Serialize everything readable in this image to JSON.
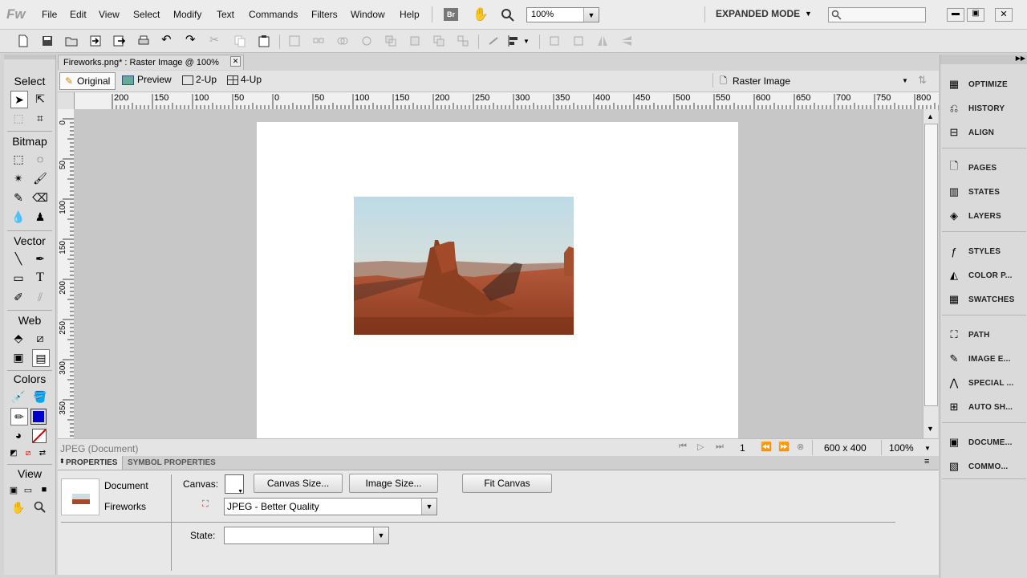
{
  "app": {
    "logo": "Fw"
  },
  "menu": [
    "File",
    "Edit",
    "View",
    "Select",
    "Modify",
    "Text",
    "Commands",
    "Filters",
    "Window",
    "Help"
  ],
  "menubar": {
    "bridge_label": "Br",
    "zoom_value": "100%",
    "mode": "EXPANDED MODE",
    "search_placeholder": ""
  },
  "doc_tab": {
    "title": "Fireworks.png* : Raster Image @ 100%"
  },
  "view_tabs": [
    "Original",
    "Preview",
    "2-Up",
    "4-Up"
  ],
  "object_type": "Raster Image",
  "ruler": {
    "h_ticks": [
      "200",
      "150",
      "100",
      "50",
      "0",
      "50",
      "100",
      "150",
      "200",
      "250",
      "300",
      "350",
      "400",
      "450",
      "500",
      "550",
      "600",
      "650",
      "700",
      "750",
      "800"
    ],
    "v_ticks": [
      "0",
      "50",
      "100",
      "150",
      "200",
      "250",
      "300",
      "350"
    ]
  },
  "tools": {
    "sections": [
      "Select",
      "Bitmap",
      "Vector",
      "Web",
      "Colors",
      "View"
    ]
  },
  "status": {
    "doc_type": "JPEG (Document)",
    "frame": "1",
    "size": "600 x 400",
    "zoom": "100%"
  },
  "properties": {
    "tabs": [
      "PROPERTIES",
      "SYMBOL PROPERTIES"
    ],
    "doc_label": "Document",
    "doc_name": "Fireworks",
    "canvas_label": "Canvas:",
    "canvas_size_btn": "Canvas Size...",
    "image_size_btn": "Image Size...",
    "fit_canvas_btn": "Fit Canvas",
    "export_format": "JPEG - Better Quality",
    "state_label": "State:",
    "state_value": ""
  },
  "panels": [
    "OPTIMIZE",
    "HISTORY",
    "ALIGN",
    "PAGES",
    "STATES",
    "LAYERS",
    "STYLES",
    "COLOR P...",
    "SWATCHES",
    "PATH",
    "IMAGE E...",
    "SPECIAL ...",
    "AUTO SH...",
    "DOCUME...",
    "COMMO..."
  ],
  "colors": {
    "stroke": "#ffffff",
    "fill": "#0000cc",
    "accent": "#1a5fb4"
  }
}
